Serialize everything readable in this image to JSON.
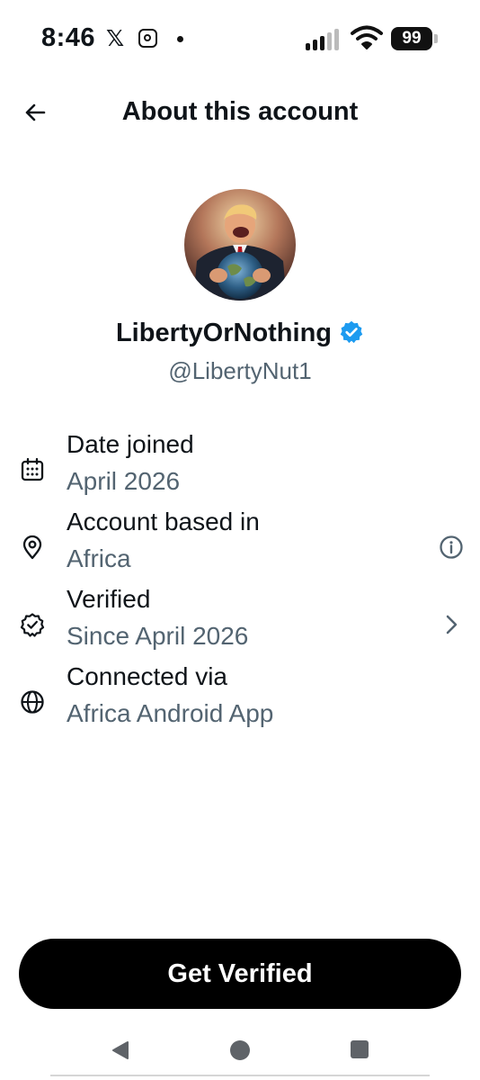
{
  "status_bar": {
    "time": "8:46",
    "battery": "99",
    "icons": [
      "x-logo-icon",
      "instagram-icon",
      "notification-dot-icon",
      "signal-icon",
      "wifi-icon",
      "battery-icon"
    ]
  },
  "header": {
    "title": "About this account",
    "back_icon": "arrow-left-icon"
  },
  "profile": {
    "display_name": "LibertyOrNothing",
    "handle": "@LibertyNut1",
    "verified": true,
    "verified_color": "#1d9bf0"
  },
  "details": [
    {
      "icon": "calendar-icon",
      "label": "Date joined",
      "value": "April 2026"
    },
    {
      "icon": "location-pin-icon",
      "label": "Account based in",
      "value": "Africa",
      "trailing_icon": "info-icon"
    },
    {
      "icon": "verified-outline-icon",
      "label": "Verified",
      "value": "Since April 2026",
      "trailing_icon": "chevron-right-icon"
    },
    {
      "icon": "globe-icon",
      "label": "Connected via",
      "value": "Africa Android App"
    }
  ],
  "cta": {
    "label": "Get Verified"
  },
  "nav_bar": {
    "icons": [
      "back-triangle-icon",
      "home-circle-icon",
      "recents-square-icon"
    ]
  },
  "colors": {
    "text": "#0f1419",
    "secondary": "#536471",
    "accent": "#1d9bf0",
    "button": "#000000"
  }
}
